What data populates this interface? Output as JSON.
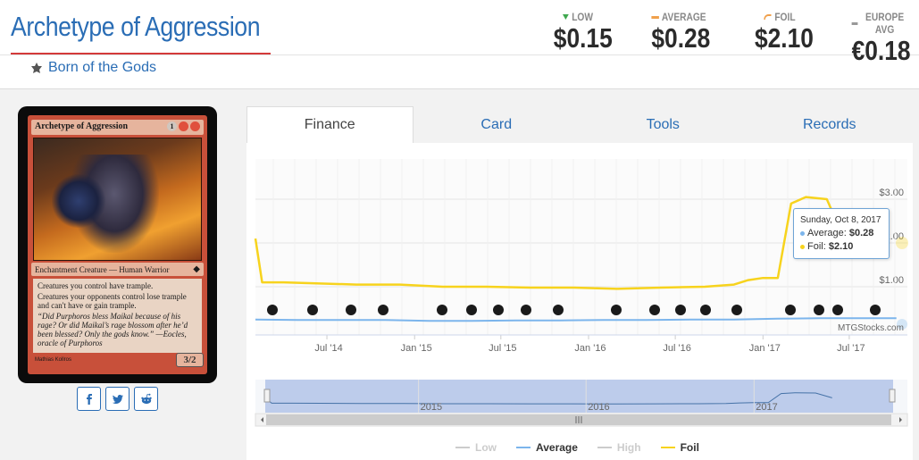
{
  "card": {
    "title": "Archetype of Aggression",
    "set_name": "Born of the Gods",
    "image": {
      "name": "Archetype of Aggression",
      "mana": [
        "1",
        "R",
        "R"
      ],
      "type_line": "Enchantment Creature — Human Warrior",
      "rules": [
        "Creatures you control have trample.",
        "Creatures your opponents control lose trample and can't have or gain trample."
      ],
      "flavor": "“Did Purphoros bless Maikal because of his rage? Or did Maikal’s rage blossom after he’d been blessed? Only the gods know.” —Eocles, oracle of Purphoros",
      "artist": "Mathias Kollros",
      "pt": "3/2"
    }
  },
  "prices": {
    "low": {
      "label": "LOW",
      "value": "$0.15",
      "color": "#3fa84f"
    },
    "average": {
      "label": "AVERAGE",
      "value": "$0.28",
      "color": "#f0a04b"
    },
    "foil": {
      "label": "FOIL",
      "value": "$2.10",
      "color": "#f0a04b"
    },
    "europe": {
      "label": "EUROPE AVG",
      "value": "€0.18",
      "color": "#999999"
    }
  },
  "share": {
    "facebook": "facebook-icon",
    "twitter": "twitter-icon",
    "reddit": "reddit-icon"
  },
  "tabs": [
    "Finance",
    "Card",
    "Tools",
    "Records"
  ],
  "active_tab": "Finance",
  "tooltip": {
    "date": "Sunday, Oct 8, 2017",
    "average_label": "Average:",
    "average_value": "$0.28",
    "foil_label": "Foil:",
    "foil_value": "$2.10"
  },
  "credit": "MTGStocks.com",
  "legend": [
    {
      "name": "Low",
      "color": "#cccccc",
      "active": false
    },
    {
      "name": "Average",
      "color": "#7cb5ec",
      "active": true
    },
    {
      "name": "High",
      "color": "#cccccc",
      "active": false
    },
    {
      "name": "Foil",
      "color": "#f7d31d",
      "active": true
    }
  ],
  "chart_data": {
    "type": "line",
    "x_ticks": [
      "Jul '14",
      "Jan '15",
      "Jul '15",
      "Jan '16",
      "Jul '16",
      "Jan '17",
      "Jul '17"
    ],
    "y_ticks": [
      "$1.00",
      "$2.00",
      "$3.00"
    ],
    "navigator_labels": [
      "2015",
      "2016",
      "2017"
    ],
    "series": [
      {
        "name": "Average",
        "color": "#7cb5ec",
        "x": [
          "2014-02-01",
          "2014-05-01",
          "2014-08-01",
          "2014-11-01",
          "2015-02-01",
          "2015-05-01",
          "2015-08-01",
          "2015-11-01",
          "2016-02-01",
          "2016-05-01",
          "2016-08-01",
          "2016-11-01",
          "2017-02-01",
          "2017-05-01",
          "2017-08-01",
          "2017-10-08"
        ],
        "values": [
          0.25,
          0.24,
          0.24,
          0.24,
          0.22,
          0.22,
          0.23,
          0.23,
          0.24,
          0.24,
          0.25,
          0.25,
          0.27,
          0.28,
          0.28,
          0.28
        ]
      },
      {
        "name": "Foil",
        "color": "#f7d31d",
        "x": [
          "2014-02-01",
          "2014-02-15",
          "2014-04-01",
          "2014-06-01",
          "2014-09-01",
          "2014-12-01",
          "2015-03-01",
          "2015-06-01",
          "2015-09-01",
          "2015-12-01",
          "2016-03-01",
          "2016-06-01",
          "2016-09-01",
          "2016-11-01",
          "2016-12-01",
          "2017-01-01",
          "2017-02-01",
          "2017-03-01",
          "2017-04-01",
          "2017-05-15",
          "2017-06-20"
        ],
        "values": [
          2.1,
          1.1,
          1.1,
          1.08,
          1.05,
          1.05,
          1.0,
          1.0,
          0.98,
          0.98,
          0.95,
          0.98,
          1.0,
          1.05,
          1.15,
          1.2,
          1.2,
          2.9,
          3.05,
          3.0,
          2.1
        ]
      }
    ],
    "set_symbols": [
      "tkt",
      "bng",
      "m15",
      "ktk",
      "frf",
      "dtk",
      "ori",
      "bfz",
      "ogw",
      "soi",
      "emn",
      "kld",
      "aer",
      "akh",
      "hou",
      "xln"
    ]
  }
}
